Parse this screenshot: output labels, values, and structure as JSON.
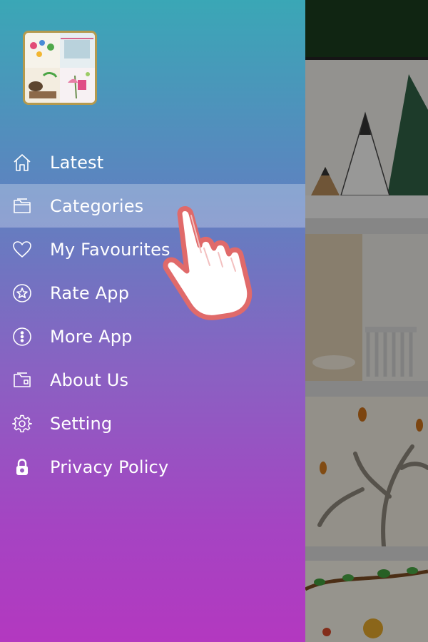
{
  "drawer": {
    "app_logo": "app-logo-thumbnail",
    "menu": [
      {
        "label": "Latest",
        "icon": "home-icon"
      },
      {
        "label": "Categories",
        "icon": "folder-icon",
        "active": true
      },
      {
        "label": "My Favourites",
        "icon": "heart-icon"
      },
      {
        "label": "Rate App",
        "icon": "star-icon"
      },
      {
        "label": "More App",
        "icon": "more-icon"
      },
      {
        "label": "About Us",
        "icon": "info-folder-icon"
      },
      {
        "label": "Setting",
        "icon": "gear-icon"
      },
      {
        "label": "Privacy Policy",
        "icon": "lock-icon"
      }
    ]
  },
  "colors": {
    "gradient_top": "#3aa7b6",
    "gradient_bottom": "#b338c0",
    "active_highlight": "rgba(255,255,255,0.28)",
    "hand_outline": "#e06a6a"
  }
}
